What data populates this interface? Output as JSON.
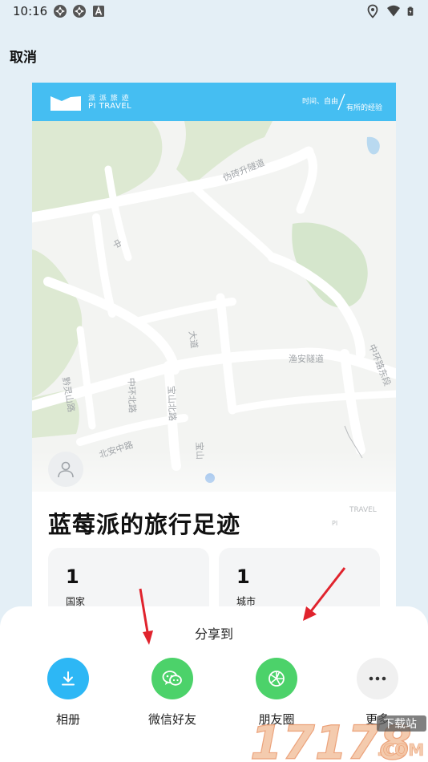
{
  "status_bar": {
    "time": "10:16",
    "left_icons": [
      "app-notification-icon",
      "app-notification-icon",
      "a-icon"
    ],
    "right_icons": [
      "location-icon",
      "wifi-icon",
      "battery-charging-icon"
    ]
  },
  "top_bar": {
    "cancel_label": "取消"
  },
  "card": {
    "brand": {
      "cn": "派 派 旅     迹",
      "en": "PI    TRAVEL"
    },
    "slogan": {
      "line1": "时间、自由",
      "line2": "有所的经验"
    },
    "map": {
      "road_labels": [
        "伪砖升隧道",
        "中",
        "大道",
        "宝山北路",
        "渔安隧道",
        "中环路东段",
        "中环北路",
        "黔灵山路",
        "北安中路",
        "宝山"
      ],
      "watermark": "TRAVEL",
      "watermark_pi": "PI"
    },
    "title": "蓝莓派的旅行足迹",
    "stats": [
      {
        "value": "1",
        "label": "国家"
      },
      {
        "value": "1",
        "label": "城市"
      }
    ]
  },
  "share_sheet": {
    "title": "分享到",
    "options": [
      {
        "label": "相册",
        "icon": "download-icon",
        "color": "#2db7f5"
      },
      {
        "label": "微信好友",
        "icon": "wechat-icon",
        "color": "#4cd26a"
      },
      {
        "label": "朋友圈",
        "icon": "moments-icon",
        "color": "#4cd26a"
      },
      {
        "label": "更多",
        "icon": "more-icon",
        "color": "#f0f0f0"
      }
    ]
  },
  "colors": {
    "header_blue": "#45bef2",
    "background": "#e4eff6",
    "annotation_arrow": "#e0232d"
  },
  "watermark": {
    "text": "17178",
    "sub": "下载站",
    "domain": ".COM"
  }
}
